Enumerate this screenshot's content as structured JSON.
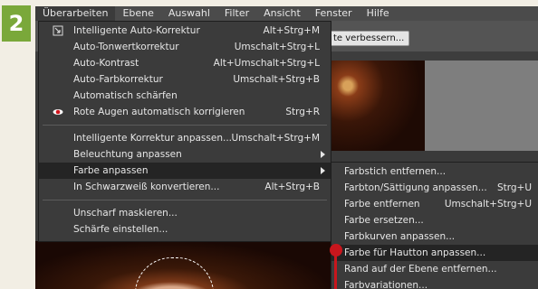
{
  "step": {
    "number": "2"
  },
  "menubar": {
    "items": [
      "Überarbeiten",
      "Ebene",
      "Auswahl",
      "Filter",
      "Ansicht",
      "Fenster",
      "Hilfe"
    ]
  },
  "toolbar": {
    "button_label": "te verbessern..."
  },
  "menu": {
    "items": [
      {
        "label": "Intelligente Auto-Korrektur",
        "shortcut": "Alt+Strg+M",
        "icon": "auto-fix-icon"
      },
      {
        "label": "Auto-Tonwertkorrektur",
        "shortcut": "Umschalt+Strg+L"
      },
      {
        "label": "Auto-Kontrast",
        "shortcut": "Alt+Umschalt+Strg+L"
      },
      {
        "label": "Auto-Farbkorrektur",
        "shortcut": "Umschalt+Strg+B"
      },
      {
        "label": "Automatisch schärfen",
        "shortcut": ""
      },
      {
        "label": "Rote Augen automatisch korrigieren",
        "shortcut": "Strg+R",
        "icon": "red-eye-icon"
      },
      {
        "label": "Intelligente Korrektur anpassen...",
        "shortcut": "Umschalt+Strg+M"
      },
      {
        "label": "Beleuchtung anpassen",
        "shortcut": ""
      },
      {
        "label": "Farbe anpassen",
        "shortcut": ""
      },
      {
        "label": "In Schwarzweiß konvertieren...",
        "shortcut": "Alt+Strg+B"
      },
      {
        "label": "Unscharf maskieren...",
        "shortcut": ""
      },
      {
        "label": "Schärfe einstellen...",
        "shortcut": ""
      }
    ]
  },
  "submenu": {
    "items": [
      {
        "label": "Farbstich entfernen...",
        "shortcut": ""
      },
      {
        "label": "Farbton/Sättigung anpassen...",
        "shortcut": "Strg+U"
      },
      {
        "label": "Farbe entfernen",
        "shortcut": "Umschalt+Strg+U"
      },
      {
        "label": "Farbe ersetzen...",
        "shortcut": ""
      },
      {
        "label": "Farbkurven anpassen...",
        "shortcut": ""
      },
      {
        "label": "Farbe für Hautton anpassen...",
        "shortcut": ""
      },
      {
        "label": "Rand auf der Ebene entfernen...",
        "shortcut": ""
      },
      {
        "label": "Farbvariationen...",
        "shortcut": ""
      }
    ]
  },
  "colors": {
    "accent_badge": "#7aa83a",
    "marker": "#c8161d"
  }
}
